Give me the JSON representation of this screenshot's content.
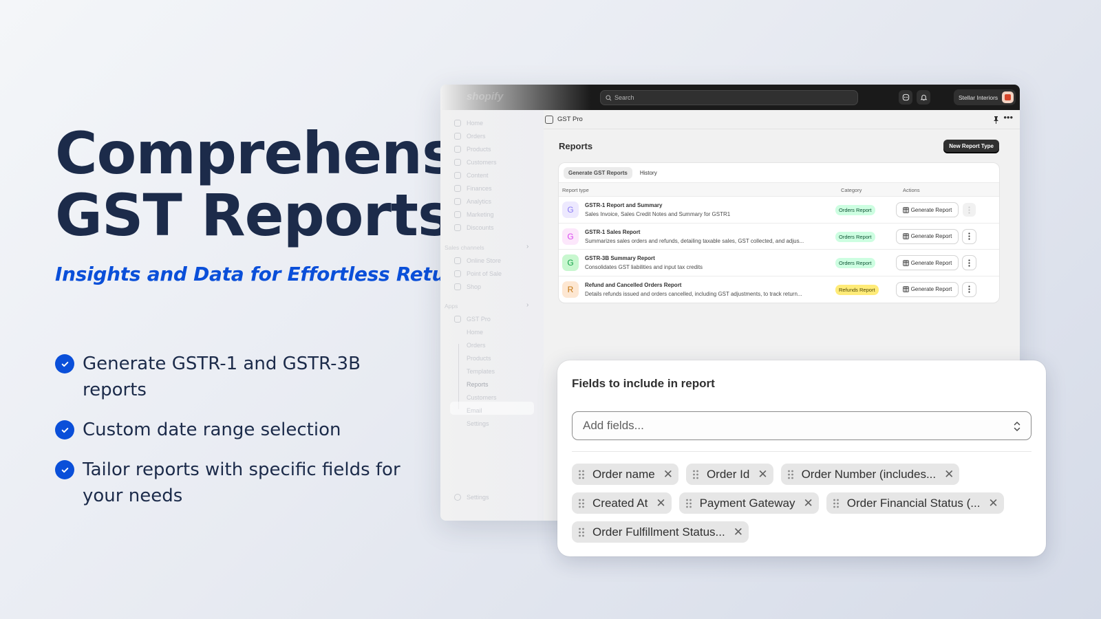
{
  "hero": {
    "title_line1": "Comprehensive",
    "title_line2": "GST Reports",
    "subtitle": "Insights and Data for Effortless Return Filing",
    "features": [
      "Generate GSTR-1 and GSTR-3B reports",
      "Custom date range selection",
      "Tailor reports with specific fields for your needs"
    ],
    "accent_color": "#0a4fd9",
    "heading_color": "#1c2b4a"
  },
  "app": {
    "logo": "shopify",
    "search": {
      "placeholder": "Search",
      "icon": "search-icon"
    },
    "store_name": "Stellar Interiors",
    "sidebar": {
      "items": [
        "Home",
        "Orders",
        "Products",
        "Customers",
        "Content",
        "Finances",
        "Analytics",
        "Marketing",
        "Discounts"
      ],
      "sales_channels_label": "Sales channels",
      "sales_channels": [
        "Online Store",
        "Point of Sale",
        "Shop"
      ],
      "apps_label": "Apps",
      "app_name": "GST Pro",
      "app_subitems": [
        "Home",
        "Orders",
        "Products",
        "Templates",
        "Reports",
        "Customers",
        "Email",
        "Settings"
      ],
      "active_subitem": "Reports",
      "settings_label": "Settings"
    },
    "app_bar": {
      "name": "GST Pro",
      "pin_icon": "pin-icon",
      "more_icon": "more-horizontal-icon"
    },
    "page": {
      "title": "Reports",
      "primary_action": "New Report Type",
      "tabs": [
        {
          "label": "Generate GST Reports",
          "active": true
        },
        {
          "label": "History",
          "active": false
        }
      ],
      "columns": [
        "Report type",
        "Category",
        "Actions"
      ],
      "rows": [
        {
          "initial": "G",
          "avatar_bg": "#ede9fe",
          "avatar_fg": "#8b7cf6",
          "title": "GSTR-1 Report and Summary",
          "description": "Sales Invoice, Sales Credit Notes and Summary for GSTR1",
          "category": "Orders Report",
          "badge_bg": "#cdfee1",
          "badge_fg": "#0c5132",
          "action": "Generate Report",
          "menu_disabled": true
        },
        {
          "initial": "G",
          "avatar_bg": "#fce7fb",
          "avatar_fg": "#d946ef",
          "title": "GSTR-1 Sales Report",
          "description": "Summarizes sales orders and refunds, detailing taxable sales, GST collected, and adjus...",
          "category": "Orders Report",
          "badge_bg": "#cdfee1",
          "badge_fg": "#0c5132",
          "action": "Generate Report",
          "menu_disabled": false
        },
        {
          "initial": "G",
          "avatar_bg": "#c8f7cf",
          "avatar_fg": "#16a34a",
          "title": "GSTR-3B Summary Report",
          "description": "Consolidates GST liabilities and input tax credits",
          "category": "Orders Report",
          "badge_bg": "#cdfee1",
          "badge_fg": "#0c5132",
          "action": "Generate Report",
          "menu_disabled": false
        },
        {
          "initial": "R",
          "avatar_bg": "#fde7d2",
          "avatar_fg": "#c2740c",
          "title": "Refund and Cancelled Orders Report",
          "description": "Details refunds issued and orders cancelled, including GST adjustments, to track return...",
          "category": "Refunds Report",
          "badge_bg": "#ffeb78",
          "badge_fg": "#4f4700",
          "action": "Generate Report",
          "menu_disabled": false
        }
      ]
    }
  },
  "fields_panel": {
    "title": "Fields to include in report",
    "select_placeholder": "Add fields...",
    "chips": [
      "Order name",
      "Order Id",
      "Order Number (includes...",
      "Created At",
      "Payment Gateway",
      "Order Financial Status (...",
      "Order Fulfillment Status..."
    ]
  }
}
